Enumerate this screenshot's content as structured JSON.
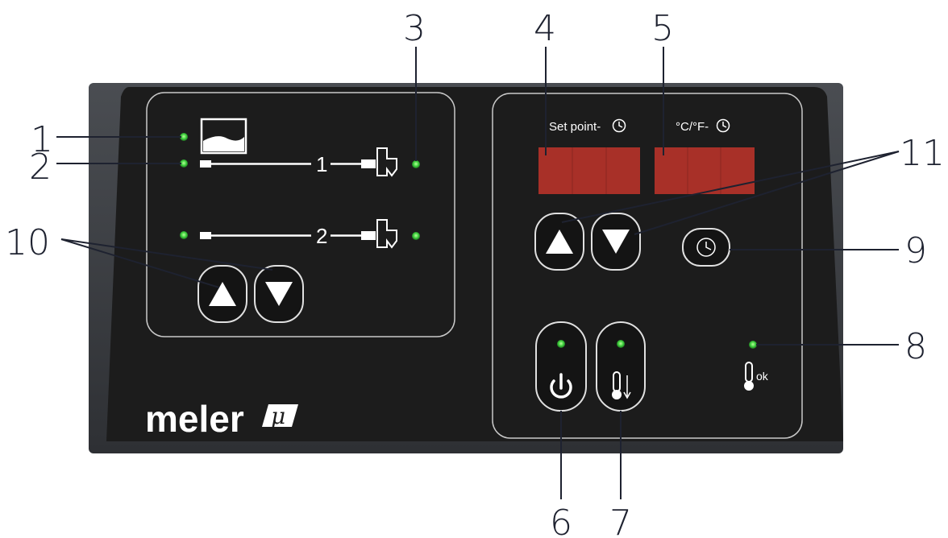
{
  "brand": {
    "name": "meler",
    "logo_mark": "μ"
  },
  "left_panel": {
    "hose_1_label": "1",
    "hose_2_label": "2",
    "adjust_up_icon": "triangle-up-icon",
    "adjust_down_icon": "triangle-down-icon"
  },
  "right_panel": {
    "setpoint_label": "Set point-",
    "unit_label": "°C/°F-",
    "ok_label": "ok",
    "power_icon": "power-icon",
    "standby_icon": "thermometer-down-icon",
    "timer_icon": "clock-icon"
  },
  "callouts": [
    "1",
    "2",
    "3",
    "4",
    "5",
    "6",
    "7",
    "8",
    "9",
    "10",
    "11"
  ],
  "colors": {
    "panel": "#1c1c1c",
    "housing": "#3a3d42",
    "led": "#3fd13f",
    "display": "#a83028",
    "callout_text": "#1e2230"
  }
}
